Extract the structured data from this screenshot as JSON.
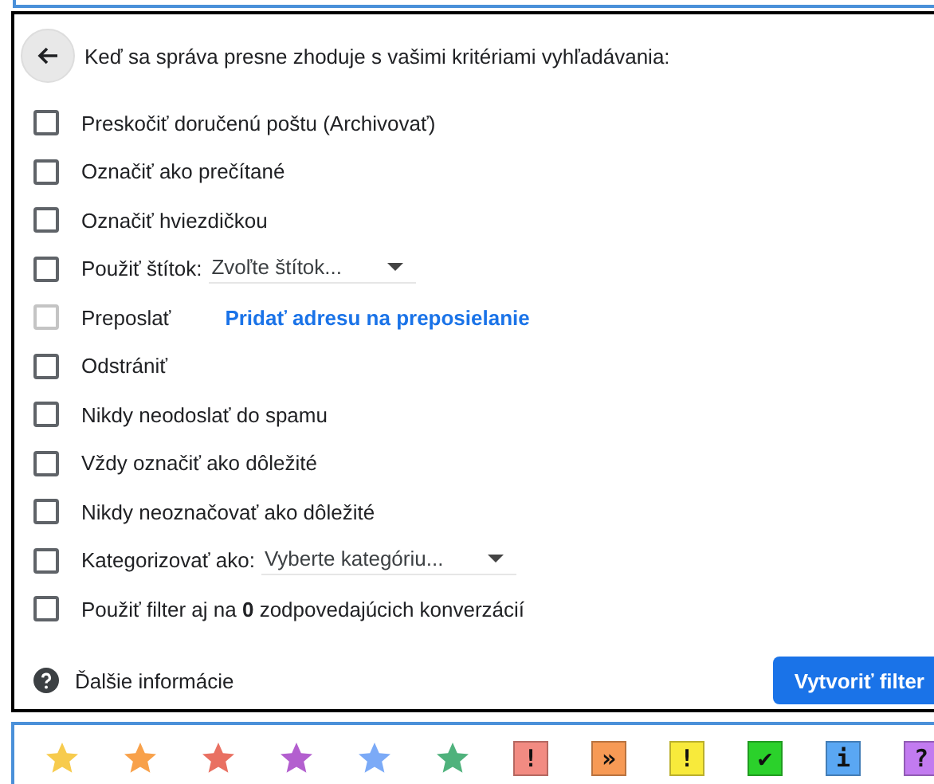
{
  "heading": "Keď sa správa presne zhoduje s vašimi kritériami vyhľadávania:",
  "options": [
    {
      "kind": "plain",
      "label": "Preskočiť doručenú poštu (Archivovať)",
      "checked": false,
      "disabled": false
    },
    {
      "kind": "plain",
      "label": "Označiť ako prečítané",
      "checked": false,
      "disabled": false
    },
    {
      "kind": "plain",
      "label": "Označiť hviezdičkou",
      "checked": false,
      "disabled": false
    },
    {
      "kind": "select",
      "label": "Použiť štítok:",
      "value": "Zvoľte štítok...",
      "checked": false,
      "disabled": false
    },
    {
      "kind": "link",
      "label": "Preposlať",
      "link": "Pridať adresu na preposielanie",
      "checked": false,
      "disabled": true
    },
    {
      "kind": "plain",
      "label": "Odstrániť",
      "checked": false,
      "disabled": false
    },
    {
      "kind": "plain",
      "label": "Nikdy neodoslať do spamu",
      "checked": false,
      "disabled": false
    },
    {
      "kind": "plain",
      "label": "Vždy označiť ako dôležité",
      "checked": false,
      "disabled": false
    },
    {
      "kind": "plain",
      "label": "Nikdy neoznačovať ako dôležité",
      "checked": false,
      "disabled": false
    },
    {
      "kind": "select",
      "label": "Kategorizovať ako:",
      "value": "Vyberte kategóriu...",
      "checked": false,
      "disabled": false
    },
    {
      "kind": "plain",
      "label": "Použiť filter aj na **0** zodpovedajúcich konverzácií",
      "checked": false,
      "disabled": false
    }
  ],
  "help_link": "Ďalšie informácie",
  "create_button": "Vytvoriť filter",
  "markers": [
    {
      "kind": "star",
      "color": "#f7cb4d"
    },
    {
      "kind": "star",
      "color": "#f8a14a"
    },
    {
      "kind": "star",
      "color": "#e97062"
    },
    {
      "kind": "star",
      "color": "#b35fcf"
    },
    {
      "kind": "star",
      "color": "#7baaf7"
    },
    {
      "kind": "star",
      "color": "#4fb27c"
    },
    {
      "kind": "badge",
      "color": "#f28b82",
      "glyph": "!"
    },
    {
      "kind": "badge",
      "color": "#f79a55",
      "glyph": "»"
    },
    {
      "kind": "badge",
      "color": "#f8ea3b",
      "glyph": "!"
    },
    {
      "kind": "badge",
      "color": "#2bd12b",
      "glyph": "✔"
    },
    {
      "kind": "badge",
      "color": "#5aa7f3",
      "glyph": "i"
    },
    {
      "kind": "badge",
      "color": "#c27bf0",
      "glyph": "?"
    }
  ]
}
